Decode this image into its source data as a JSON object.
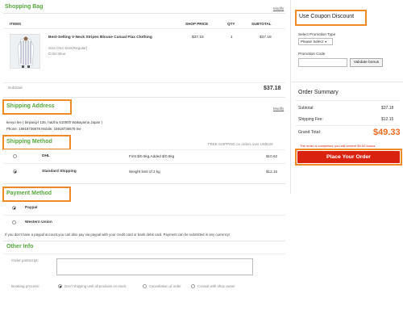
{
  "shopping_bag": {
    "title": "Shopping Bag",
    "modify": "Modify",
    "columns": {
      "items": "ITEMS",
      "price": "SHOP PRICE",
      "qty": "QTY",
      "subtotal": "SUBTOTAL"
    },
    "item": {
      "name": "Best-Selling V-Neck Stripes Blouse Casual Flax Clothing",
      "size": "Size:One Size(Regular)",
      "color": "Color:Blue",
      "price": "$37.18",
      "qty": "1",
      "subtotal": "$37.18"
    },
    "subtotal_label": "Subtotal",
    "subtotal_value": "$37.18"
  },
  "shipping_address": {
    "title": "Shipping Address",
    "modify": "Modify",
    "name_line": "kenyo lee ( binjiang-l 136, haizhu 510000 Wakayama Japan )",
    "phone_line": "Phone: 15918736678 Mobile: 15918736678 lee"
  },
  "shipping_method": {
    "title": "Shipping Method",
    "free_note": "FREE SHIPPING on orders over US$129",
    "options": [
      {
        "name": "DHL",
        "desc": "First $/0.5kg,Added $/0.5kg",
        "price": "$10.62",
        "selected": false
      },
      {
        "name": "Standard Shipping",
        "desc": "Weight limit of 2 kg",
        "price": "$12.15",
        "selected": true
      }
    ]
  },
  "payment_method": {
    "title": "Payment Method",
    "options": [
      {
        "name": "Paypal",
        "selected": true
      },
      {
        "name": "Western Union",
        "selected": false
      }
    ],
    "note": "If you don't have a paypal account,you can also pay via paypal with your credit card or bank debit card. Payment can be submitted in any currency!"
  },
  "other_info": {
    "title": "Other Info",
    "order_postscript_label": "Order postscript:",
    "booking_label": "Booking process:",
    "booking_options": [
      "Don't shipping until all products ex-stock",
      "Cancellation of order",
      "Consult with shop owner"
    ]
  },
  "coupon": {
    "title": "Use Coupon Discount",
    "promotion_type_label": "Select Promotion Type",
    "select_value": "Please Select",
    "promotion_code_label": "Promotion Code",
    "code_placeholder": "",
    "validate_label": "Validate bonus"
  },
  "order_summary": {
    "title": "Order Summary",
    "subtotal_label": "Subtotal:",
    "subtotal_value": "$37.18",
    "shipping_label": "Shipping Fee:",
    "shipping_value": "$12.15",
    "grand_label": "Grand Total:",
    "grand_value": "$49.33",
    "bonus_note": "The order is completed, you will receive $0.00 bonus",
    "place_order_label": "Place Your Order"
  },
  "colors": {
    "accent_green": "#56a83c",
    "highlight_orange": "#f08a24",
    "place_order_red": "#d9230f",
    "grand_total_orange": "#ef6a1f"
  }
}
